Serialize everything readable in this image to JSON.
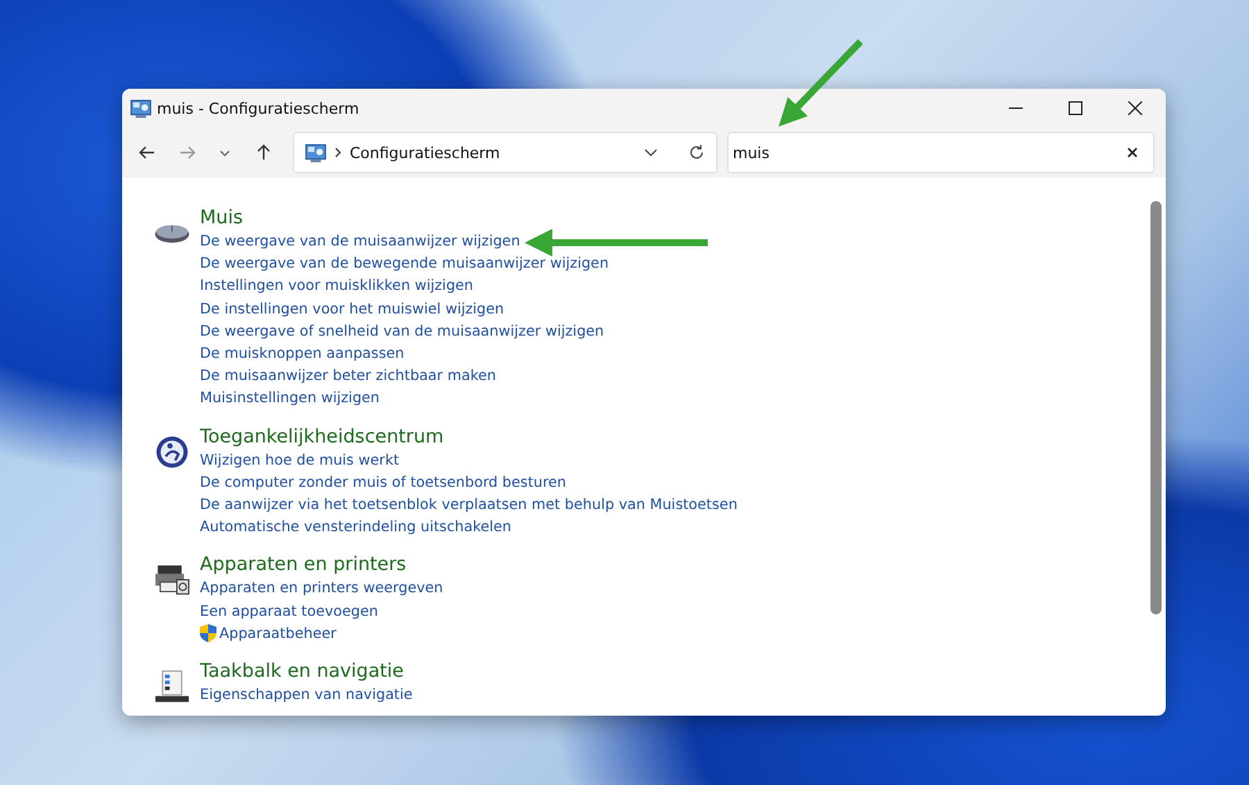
{
  "window": {
    "title": "muis - Configuratiescherm"
  },
  "address_bar": {
    "location": "Configuratiescherm"
  },
  "search": {
    "value": "muis"
  },
  "sections": [
    {
      "kind": "mouse",
      "title": "Muis",
      "links": [
        {
          "label": "De weergave van de muisaanwijzer wijzigen",
          "shield": false
        },
        {
          "label": "De weergave van de bewegende muisaanwijzer wijzigen",
          "shield": false
        },
        {
          "label": "Instellingen voor muisklikken wijzigen",
          "shield": false
        },
        {
          "label": "De instellingen voor het muiswiel wijzigen",
          "shield": false
        },
        {
          "label": "De weergave of snelheid van de muisaanwijzer wijzigen",
          "shield": false
        },
        {
          "label": "De muisknoppen aanpassen",
          "shield": false
        },
        {
          "label": "De muisaanwijzer beter zichtbaar maken",
          "shield": false
        },
        {
          "label": "Muisinstellingen wijzigen",
          "shield": false
        }
      ]
    },
    {
      "kind": "accessibility",
      "title": "Toegankelijkheidscentrum",
      "links": [
        {
          "label": "Wijzigen hoe de muis werkt",
          "shield": false
        },
        {
          "label": "De computer zonder muis of toetsenbord besturen",
          "shield": false
        },
        {
          "label": "De aanwijzer via het toetsenblok verplaatsen met behulp van Muistoetsen",
          "shield": false
        },
        {
          "label": "Automatische vensterindeling uitschakelen",
          "shield": false
        }
      ]
    },
    {
      "kind": "printer",
      "title": "Apparaten en printers",
      "links": [
        {
          "label": "Apparaten en printers weergeven",
          "shield": false
        },
        {
          "label": "Een apparaat toevoegen",
          "shield": false
        },
        {
          "label": "Apparaatbeheer",
          "shield": true
        }
      ]
    },
    {
      "kind": "taskbar",
      "title": "Taakbalk en navigatie",
      "links": [
        {
          "label": "Eigenschappen van navigatie",
          "shield": false
        }
      ]
    }
  ]
}
